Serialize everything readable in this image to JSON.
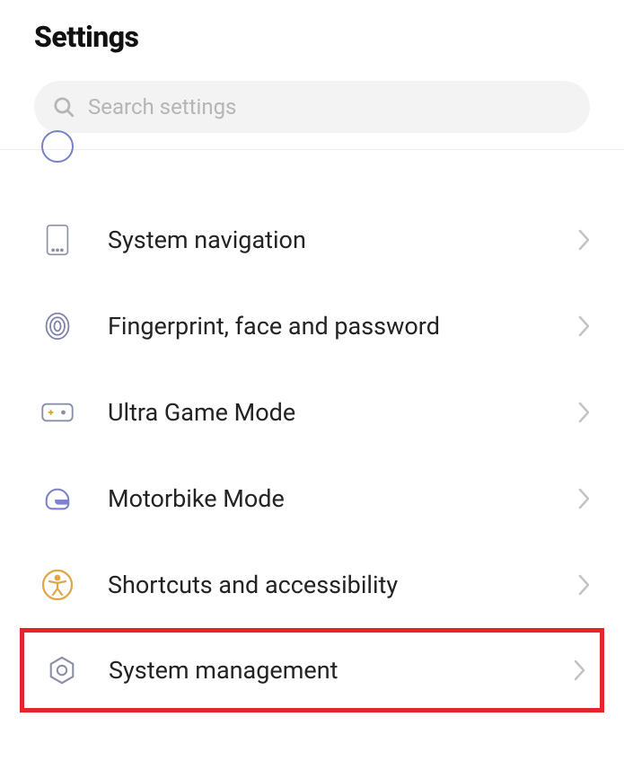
{
  "header": {
    "title": "Settings"
  },
  "search": {
    "placeholder": "Search settings"
  },
  "items": {
    "system_navigation": "System navigation",
    "fingerprint": "Fingerprint, face and password",
    "ultra_game": "Ultra Game Mode",
    "motorbike": "Motorbike Mode",
    "shortcuts": "Shortcuts and accessibility",
    "system_mgmt": "System management"
  }
}
